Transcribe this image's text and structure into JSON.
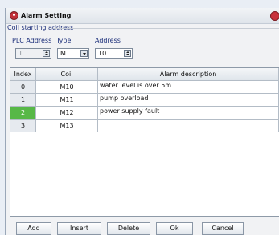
{
  "window": {
    "title": "Alarm Setting"
  },
  "group": {
    "label": "Coil starting address"
  },
  "plc_address": {
    "label": "PLC Address",
    "value": "1"
  },
  "type": {
    "label": "Type",
    "value": "M"
  },
  "address": {
    "label": "Address",
    "value": "10"
  },
  "table": {
    "headers": [
      "Index",
      "Coil",
      "Alarm description"
    ],
    "rows": [
      {
        "index": "0",
        "coil": "M10",
        "description": "water level is over 5m"
      },
      {
        "index": "1",
        "coil": "M11",
        "description": "pump overload"
      },
      {
        "index": "2",
        "coil": "M12",
        "description": "power supply fault"
      },
      {
        "index": "3",
        "coil": "M13",
        "description": ""
      }
    ],
    "selected_index": "2"
  },
  "buttons": {
    "add": "Add",
    "insert": "Insert",
    "delete": "Delete",
    "ok": "Ok",
    "cancel": "Cancel"
  },
  "colors": {
    "selected_row": "#57b847",
    "label_text": "#1c2f7a",
    "title_icon": "#c0303a"
  }
}
